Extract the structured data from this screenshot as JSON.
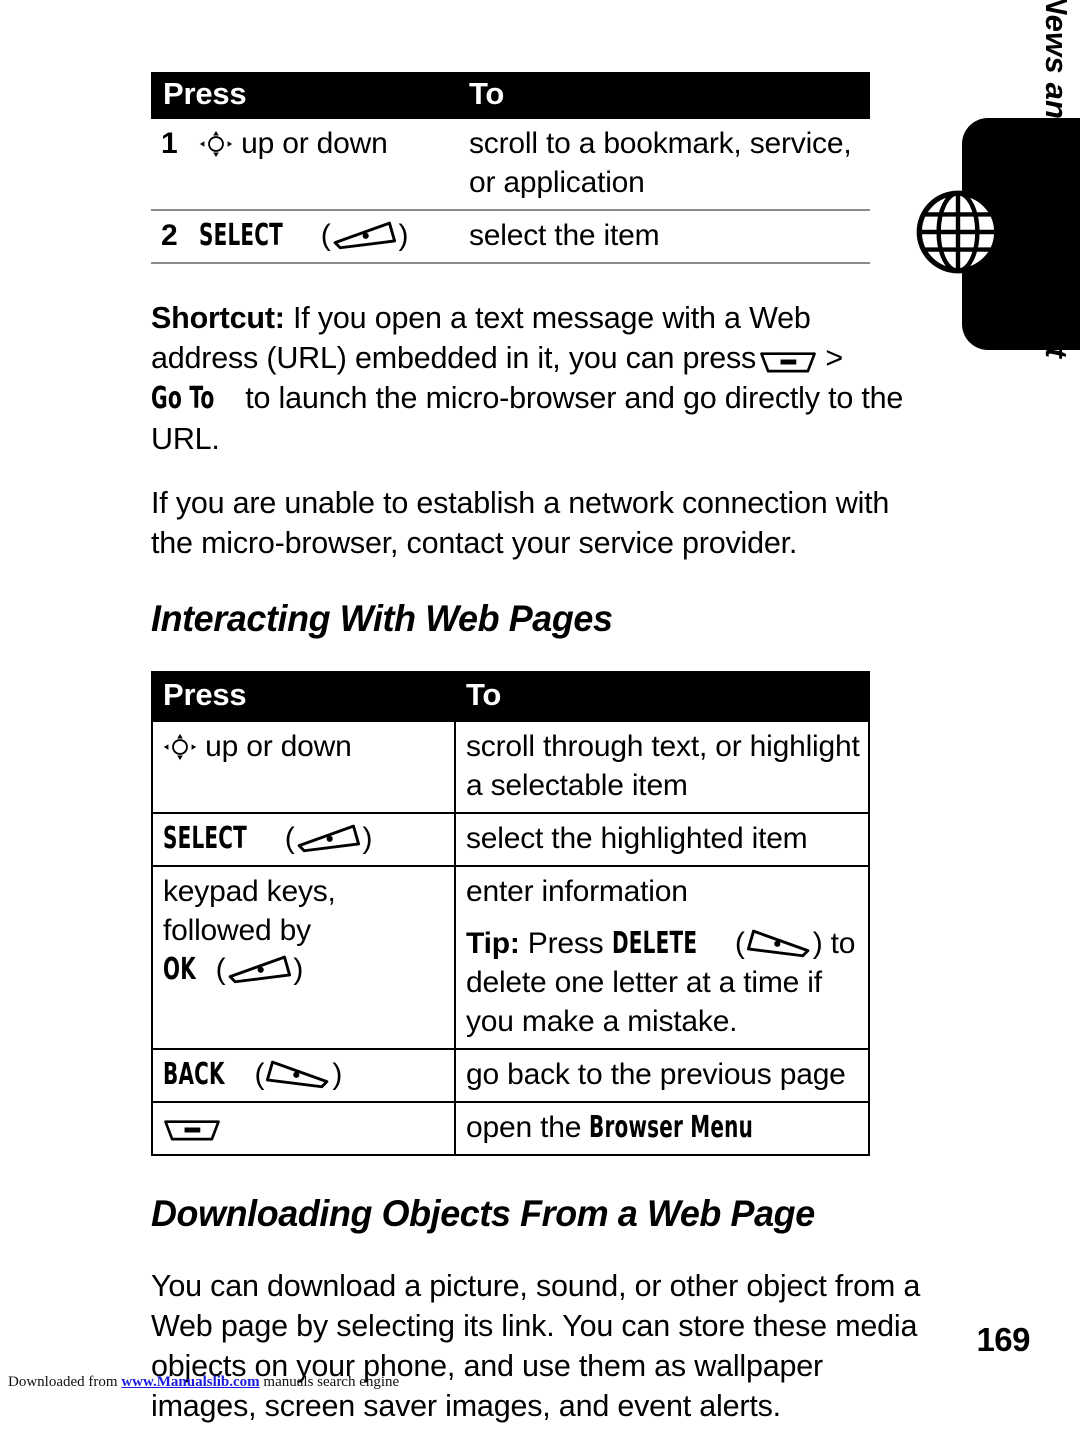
{
  "document": {
    "page_number": "169",
    "side_tab_label": "News and Entertainment",
    "side_tab_icon": "globe-icon"
  },
  "steps_table": {
    "headers": {
      "press": "Press",
      "to": "To"
    },
    "rows": [
      {
        "num": "1",
        "press_icon": "navigation-key-icon",
        "press_text": "up or down",
        "to_text": "scroll to a bookmark, service, or application"
      },
      {
        "num": "2",
        "press_label": "SELECT",
        "press_icon": "left-soft-key-icon",
        "to_text": "select the item"
      }
    ]
  },
  "shortcut_paragraph": {
    "label": "Shortcut:",
    "text_before": "If you open a text message with a Web address (URL) embedded in it, you can press",
    "key_icon": "menu-key-icon",
    "arrow": ">",
    "menu_item": "Go To",
    "text_after": "to launch the micro-browser and go directly to the URL."
  },
  "network_paragraph": {
    "text": "If you are unable to establish a network connection with the micro-browser, contact your service provider."
  },
  "section_interacting": {
    "heading": "Interacting With Web Pages",
    "table": {
      "headers": {
        "press": "Press",
        "to": "To"
      },
      "rows": [
        {
          "press_icon": "navigation-key-icon",
          "press_text": "up or down",
          "to_text": "scroll through text, or highlight a selectable item"
        },
        {
          "press_label": "SELECT",
          "press_icon": "left-soft-key-icon",
          "to_text": "select the highlighted item"
        },
        {
          "press_text_line1": "keypad keys,",
          "press_text_line2": "followed by",
          "press_label": "OK",
          "press_icon": "left-soft-key-icon",
          "to_text": "enter information",
          "tip_label": "Tip:",
          "tip_text_before": "Press",
          "tip_key_label": "DELETE",
          "tip_key_icon": "right-soft-key-icon",
          "tip_text_after": "to delete one letter at a time if you make a mistake."
        },
        {
          "press_label": "BACK",
          "press_icon": "right-soft-key-icon",
          "to_text": "go back to the previous page"
        },
        {
          "press_icon": "menu-key-icon",
          "to_text_before": "open the",
          "to_menu_label": "Browser Menu"
        }
      ]
    }
  },
  "section_downloading": {
    "heading": "Downloading Objects From a Web Page",
    "paragraph": "You can download a picture, sound, or other object from a Web page by selecting its link. You can store these media objects on your phone, and use them as wallpaper images, screen saver images, and event alerts."
  },
  "footer": {
    "prefix": "Downloaded from",
    "link": "www.Manualslib.com",
    "suffix": "manuals search engine"
  }
}
